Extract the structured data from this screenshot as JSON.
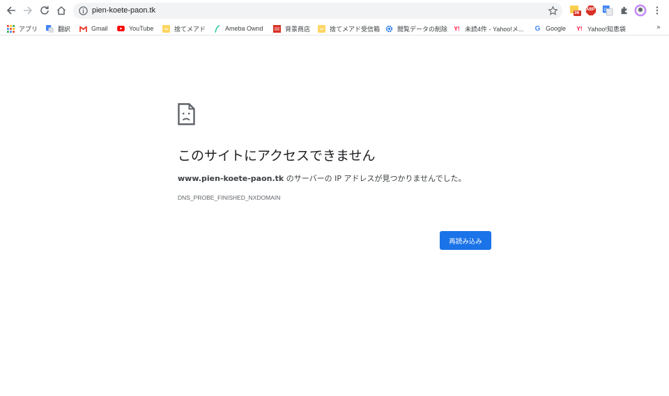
{
  "browser": {
    "url": "pien-koete-paon.tk",
    "extension_badge": "36",
    "extension_abp_label": "ABP"
  },
  "bookmarks": {
    "items": [
      {
        "label": "アプリ"
      },
      {
        "label": "翻訳"
      },
      {
        "label": "Gmail"
      },
      {
        "label": "YouTube"
      },
      {
        "label": "捨てメアド"
      },
      {
        "label": "Ameba Ownd"
      },
      {
        "label": "背景商店"
      },
      {
        "label": "捨てメアド受信箱"
      },
      {
        "label": "閲覧データの削除"
      },
      {
        "label": "未読4件 - Yahoo!メ..."
      },
      {
        "label": "Google"
      },
      {
        "label": "Yahoo!知恵袋"
      }
    ],
    "overflow": "»"
  },
  "error": {
    "title": "このサイトにアクセスできません",
    "host": "www.pien-koete-paon.tk",
    "message": " のサーバーの IP アドレスが見つかりませんでした。",
    "code": "DNS_PROBE_FINISHED_NXDOMAIN",
    "reload_label": "再読み込み"
  },
  "colors": {
    "accent": "#1a73e8",
    "text": "#202124"
  }
}
